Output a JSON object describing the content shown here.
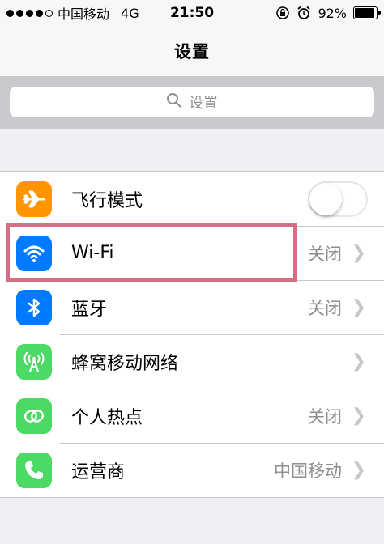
{
  "status_bar": {
    "carrier": "中国移动",
    "network": "4G",
    "time": "21:50",
    "battery": "92%",
    "battery_level": 0.92,
    "signal_filled": 4,
    "signal_total": 5
  },
  "nav": {
    "title": "设置"
  },
  "search": {
    "placeholder": "设置"
  },
  "colors": {
    "airplane": "#ff9500",
    "wifi": "#007aff",
    "bluetooth": "#007aff",
    "cellular": "#4cd964",
    "hotspot": "#4cd964",
    "carrier": "#4cd964",
    "highlight": "#d36e83"
  },
  "settings": [
    {
      "label": "飞行模式",
      "icon": "airplane-icon",
      "type": "toggle",
      "value": "",
      "toggle_on": false
    },
    {
      "label": "Wi-Fi",
      "icon": "wifi-icon",
      "type": "link",
      "value": "关闭"
    },
    {
      "label": "蓝牙",
      "icon": "bluetooth-icon",
      "type": "link",
      "value": "关闭"
    },
    {
      "label": "蜂窝移动网络",
      "icon": "cellular-icon",
      "type": "link",
      "value": ""
    },
    {
      "label": "个人热点",
      "icon": "hotspot-icon",
      "type": "link",
      "value": "关闭"
    },
    {
      "label": "运营商",
      "icon": "phone-icon",
      "type": "link",
      "value": "中国移动"
    }
  ]
}
